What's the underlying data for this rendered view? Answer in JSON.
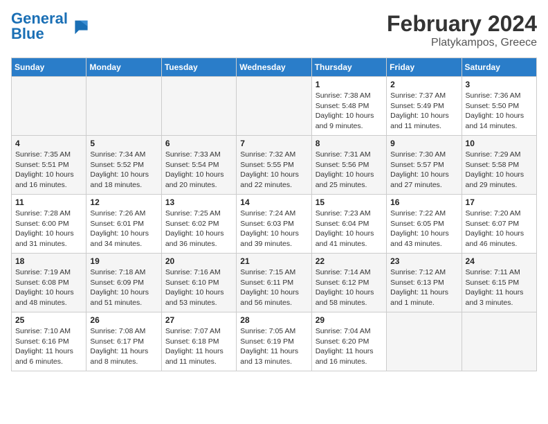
{
  "header": {
    "logo_general": "General",
    "logo_blue": "Blue",
    "title": "February 2024",
    "subtitle": "Platykampos, Greece"
  },
  "days_of_week": [
    "Sunday",
    "Monday",
    "Tuesday",
    "Wednesday",
    "Thursday",
    "Friday",
    "Saturday"
  ],
  "weeks": [
    [
      {
        "day": "",
        "info": ""
      },
      {
        "day": "",
        "info": ""
      },
      {
        "day": "",
        "info": ""
      },
      {
        "day": "",
        "info": ""
      },
      {
        "day": "1",
        "info": "Sunrise: 7:38 AM\nSunset: 5:48 PM\nDaylight: 10 hours\nand 9 minutes."
      },
      {
        "day": "2",
        "info": "Sunrise: 7:37 AM\nSunset: 5:49 PM\nDaylight: 10 hours\nand 11 minutes."
      },
      {
        "day": "3",
        "info": "Sunrise: 7:36 AM\nSunset: 5:50 PM\nDaylight: 10 hours\nand 14 minutes."
      }
    ],
    [
      {
        "day": "4",
        "info": "Sunrise: 7:35 AM\nSunset: 5:51 PM\nDaylight: 10 hours\nand 16 minutes."
      },
      {
        "day": "5",
        "info": "Sunrise: 7:34 AM\nSunset: 5:52 PM\nDaylight: 10 hours\nand 18 minutes."
      },
      {
        "day": "6",
        "info": "Sunrise: 7:33 AM\nSunset: 5:54 PM\nDaylight: 10 hours\nand 20 minutes."
      },
      {
        "day": "7",
        "info": "Sunrise: 7:32 AM\nSunset: 5:55 PM\nDaylight: 10 hours\nand 22 minutes."
      },
      {
        "day": "8",
        "info": "Sunrise: 7:31 AM\nSunset: 5:56 PM\nDaylight: 10 hours\nand 25 minutes."
      },
      {
        "day": "9",
        "info": "Sunrise: 7:30 AM\nSunset: 5:57 PM\nDaylight: 10 hours\nand 27 minutes."
      },
      {
        "day": "10",
        "info": "Sunrise: 7:29 AM\nSunset: 5:58 PM\nDaylight: 10 hours\nand 29 minutes."
      }
    ],
    [
      {
        "day": "11",
        "info": "Sunrise: 7:28 AM\nSunset: 6:00 PM\nDaylight: 10 hours\nand 31 minutes."
      },
      {
        "day": "12",
        "info": "Sunrise: 7:26 AM\nSunset: 6:01 PM\nDaylight: 10 hours\nand 34 minutes."
      },
      {
        "day": "13",
        "info": "Sunrise: 7:25 AM\nSunset: 6:02 PM\nDaylight: 10 hours\nand 36 minutes."
      },
      {
        "day": "14",
        "info": "Sunrise: 7:24 AM\nSunset: 6:03 PM\nDaylight: 10 hours\nand 39 minutes."
      },
      {
        "day": "15",
        "info": "Sunrise: 7:23 AM\nSunset: 6:04 PM\nDaylight: 10 hours\nand 41 minutes."
      },
      {
        "day": "16",
        "info": "Sunrise: 7:22 AM\nSunset: 6:05 PM\nDaylight: 10 hours\nand 43 minutes."
      },
      {
        "day": "17",
        "info": "Sunrise: 7:20 AM\nSunset: 6:07 PM\nDaylight: 10 hours\nand 46 minutes."
      }
    ],
    [
      {
        "day": "18",
        "info": "Sunrise: 7:19 AM\nSunset: 6:08 PM\nDaylight: 10 hours\nand 48 minutes."
      },
      {
        "day": "19",
        "info": "Sunrise: 7:18 AM\nSunset: 6:09 PM\nDaylight: 10 hours\nand 51 minutes."
      },
      {
        "day": "20",
        "info": "Sunrise: 7:16 AM\nSunset: 6:10 PM\nDaylight: 10 hours\nand 53 minutes."
      },
      {
        "day": "21",
        "info": "Sunrise: 7:15 AM\nSunset: 6:11 PM\nDaylight: 10 hours\nand 56 minutes."
      },
      {
        "day": "22",
        "info": "Sunrise: 7:14 AM\nSunset: 6:12 PM\nDaylight: 10 hours\nand 58 minutes."
      },
      {
        "day": "23",
        "info": "Sunrise: 7:12 AM\nSunset: 6:13 PM\nDaylight: 11 hours\nand 1 minute."
      },
      {
        "day": "24",
        "info": "Sunrise: 7:11 AM\nSunset: 6:15 PM\nDaylight: 11 hours\nand 3 minutes."
      }
    ],
    [
      {
        "day": "25",
        "info": "Sunrise: 7:10 AM\nSunset: 6:16 PM\nDaylight: 11 hours\nand 6 minutes."
      },
      {
        "day": "26",
        "info": "Sunrise: 7:08 AM\nSunset: 6:17 PM\nDaylight: 11 hours\nand 8 minutes."
      },
      {
        "day": "27",
        "info": "Sunrise: 7:07 AM\nSunset: 6:18 PM\nDaylight: 11 hours\nand 11 minutes."
      },
      {
        "day": "28",
        "info": "Sunrise: 7:05 AM\nSunset: 6:19 PM\nDaylight: 11 hours\nand 13 minutes."
      },
      {
        "day": "29",
        "info": "Sunrise: 7:04 AM\nSunset: 6:20 PM\nDaylight: 11 hours\nand 16 minutes."
      },
      {
        "day": "",
        "info": ""
      },
      {
        "day": "",
        "info": ""
      }
    ]
  ]
}
